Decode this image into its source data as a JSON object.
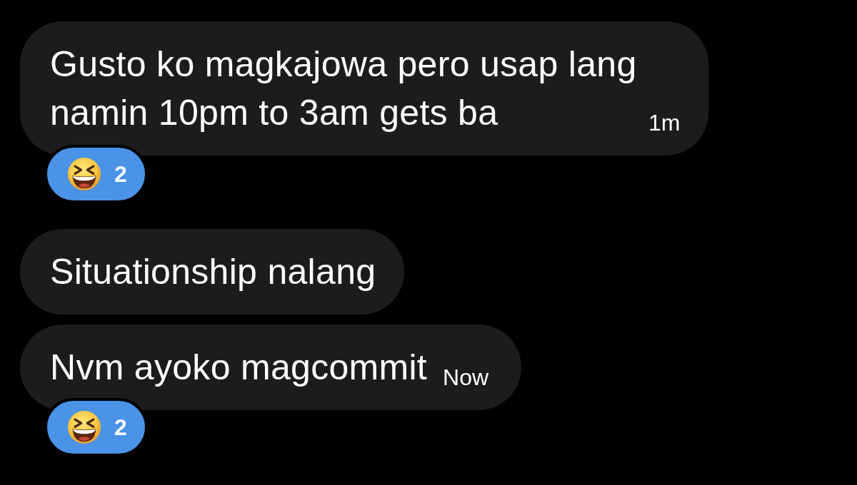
{
  "messages": [
    {
      "text": "Gusto ko magkajowa pero usap lang namin 10pm to 3am gets ba",
      "time": "1m",
      "reaction": {
        "count": "2"
      }
    },
    {
      "text": "Situationship nalang"
    },
    {
      "text": "Nvm ayoko magcommit",
      "time": "Now",
      "reaction": {
        "count": "2"
      }
    }
  ]
}
